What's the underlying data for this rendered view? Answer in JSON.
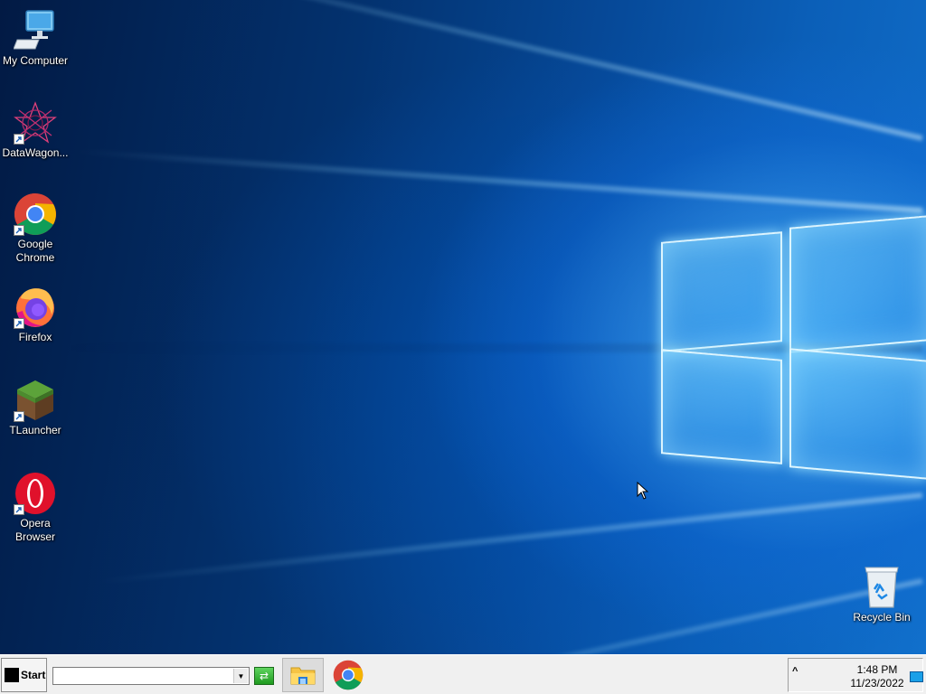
{
  "desktop": {
    "icons": [
      {
        "label": "My Computer",
        "icon": "computer-icon"
      },
      {
        "label": "DataWagon...",
        "icon": "datawagon-icon"
      },
      {
        "label": "Google Chrome",
        "icon": "chrome-icon"
      },
      {
        "label": "Firefox",
        "icon": "firefox-icon"
      },
      {
        "label": "TLauncher",
        "icon": "tlauncher-icon"
      },
      {
        "label": "Opera Browser",
        "icon": "opera-icon"
      }
    ],
    "recycle_bin": {
      "label": "Recycle Bin",
      "icon": "recycle-bin-icon"
    },
    "wallpaper_colors": {
      "dark": "#021a44",
      "mid": "#064a9a",
      "light": "#7fd0ff"
    }
  },
  "taskbar": {
    "start_label": "Start",
    "run_value": "",
    "pinned": [
      {
        "name": "file-explorer",
        "icon": "folder-icon"
      },
      {
        "name": "google-chrome",
        "icon": "chrome-icon"
      }
    ],
    "tray": {
      "chevron": "^",
      "time": "1:48 PM",
      "date": "11/23/2022"
    }
  }
}
